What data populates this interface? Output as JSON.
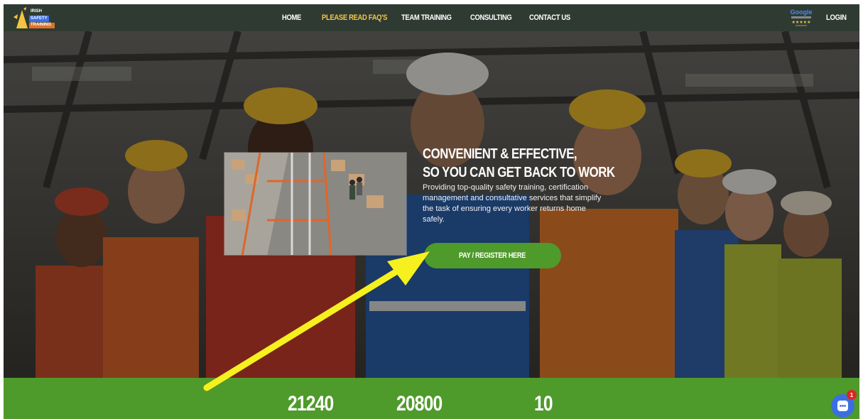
{
  "logo": {
    "line1": "IRISH",
    "line2": "SAFETY",
    "line3": "TRAINING"
  },
  "nav": {
    "home": "HOME",
    "faqs": "PLEASE READ FAQ'S",
    "team_training": "TEAM TRAINING",
    "consulting": "CONSULTING",
    "contact": "CONTACT US",
    "login": "LOGIN"
  },
  "google_badge": {
    "brand": "Google"
  },
  "hero": {
    "title_line1": "CONVENIENT & EFFECTIVE,",
    "title_line2": "SO YOU CAN GET BACK TO WORK",
    "description": "Providing top-quality safety training, certification management and consultative services that simplify the task of ensuring every worker returns home safely.",
    "cta": "PAY / REGISTER HERE"
  },
  "stats": {
    "stat1": "21240",
    "stat2": "20800",
    "stat3": "10"
  },
  "chat": {
    "badge_count": "1"
  },
  "colors": {
    "nav_bg": "#2f3b32",
    "nav_active": "#f4c542",
    "accent_green": "#4e9a2a",
    "arrow_yellow": "#f6f01e",
    "chat_blue": "#3b6fe0"
  },
  "icons": [
    "logo-star-icon",
    "google-rating-badge",
    "arrow-annotation",
    "chat-icon"
  ]
}
